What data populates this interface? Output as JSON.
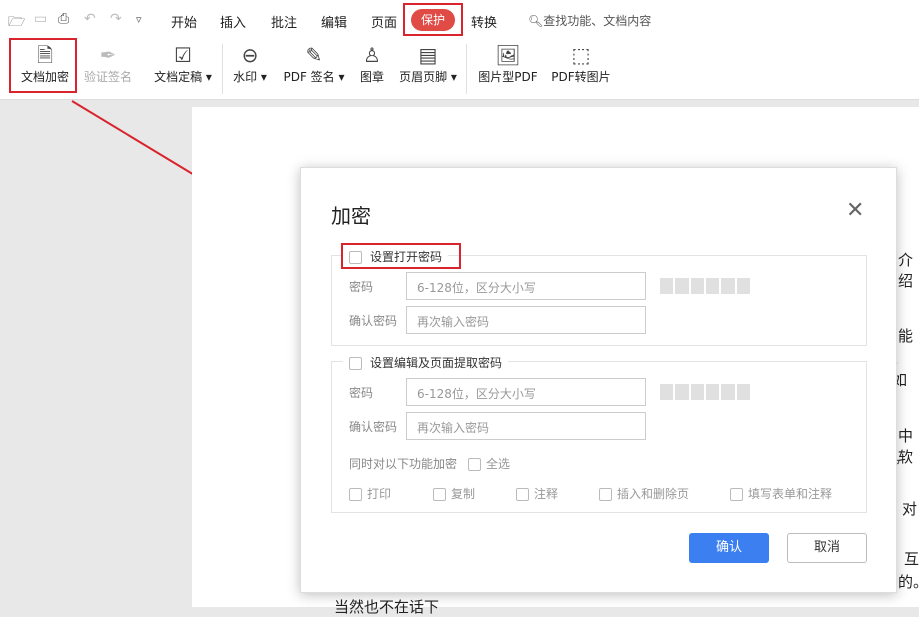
{
  "quick_access": {
    "open": "folder-icon",
    "save": "save-icon",
    "print": "print-icon",
    "undo": "undo-icon",
    "redo": "redo-icon",
    "more": "chevron-down-icon"
  },
  "tabs": [
    "开始",
    "插入",
    "批注",
    "编辑",
    "页面",
    "保护",
    "转换"
  ],
  "search": "查找功能、文档内容",
  "toolbar": [
    "文档加密",
    "验证签名",
    "文档定稿",
    "水印",
    "PDF 签名",
    "图章",
    "页眉页脚",
    "图片型PDF",
    "PDF转图片"
  ],
  "doc_fragments": [
    "介绍",
    "能",
    "。如",
    "中软",
    "。",
    "对",
    "互",
    "的。",
    "当然也不在话下"
  ],
  "dialog": {
    "title": "加密",
    "open_section": {
      "label": "设置打开密码",
      "password_label": "密码",
      "password_placeholder": "6-128位，区分大小写",
      "confirm_label": "确认密码",
      "confirm_placeholder": "再次输入密码"
    },
    "edit_section": {
      "label": "设置编辑及页面提取密码",
      "password_label": "密码",
      "password_placeholder": "6-128位，区分大小写",
      "confirm_label": "确认密码",
      "confirm_placeholder": "再次输入密码",
      "also_label": "同时对以下功能加密",
      "select_all": "全选",
      "options": [
        "打印",
        "复制",
        "注释",
        "插入和删除页",
        "填写表单和注释"
      ]
    },
    "ok": "确认",
    "cancel": "取消"
  },
  "colors": {
    "accent": "#3b7ff0",
    "protect_tab": "#e04b45",
    "highlight": "#d9232d"
  }
}
